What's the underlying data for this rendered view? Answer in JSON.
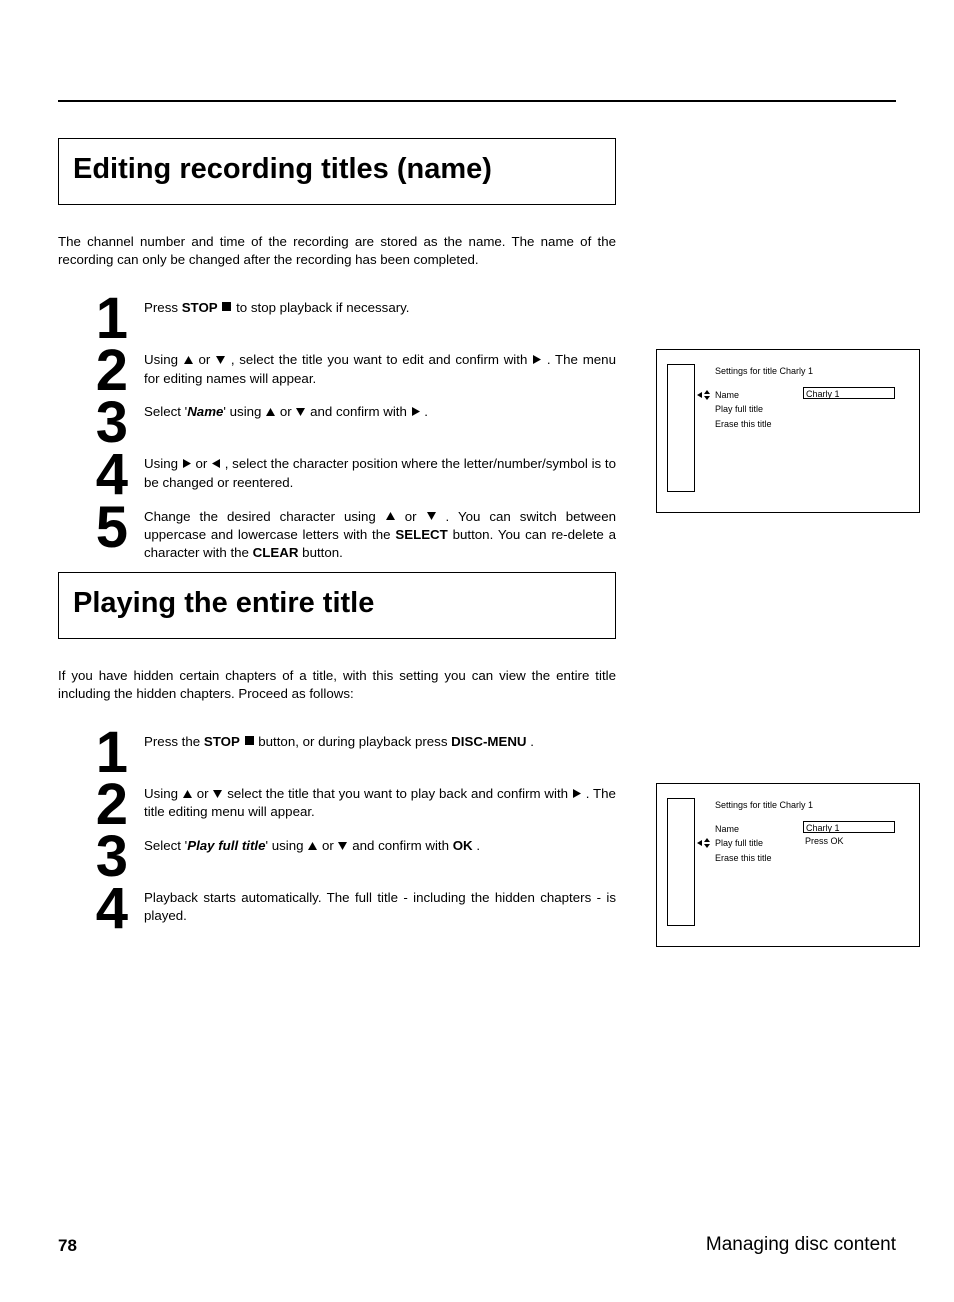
{
  "section1": {
    "title": "Editing recording titles (name)",
    "intro": "The channel number and time of the recording are stored as the name. The name of the recording can only be changed after the recording has been completed.",
    "steps": {
      "s1": {
        "num": "1",
        "pre": "Press ",
        "btn": "STOP",
        "post": " to stop playback if necessary."
      },
      "s2": {
        "num": "2",
        "pre": "Using ",
        "mid": " , select the title you want to edit and confirm with ",
        "post": " . The menu for editing names will appear."
      },
      "s3": {
        "num": "3",
        "pre": "Select '",
        "name": "Name",
        "mid": "' using ",
        "mid2": " and confirm with ",
        "post": " ."
      },
      "s4": {
        "num": "4",
        "pre": "Using ",
        "post": " , select the character position where the letter/number/symbol is to be changed or reentered."
      },
      "s5": {
        "num": "5",
        "pre": "Change the desired character using ",
        "mid": " . You can switch between uppercase and lowercase letters with the ",
        "btn1": "SELECT",
        "mid2": " button. You can re-delete a character with the ",
        "btn2": "CLEAR",
        "post": " button."
      }
    }
  },
  "section2": {
    "title": "Playing the entire title",
    "intro": "If you have hidden certain chapters of a title, with this setting you can view the entire title including the hidden chapters. Proceed as follows:",
    "steps": {
      "s1": {
        "num": "1",
        "pre": "Press the ",
        "btn1": "STOP",
        "mid": " button, or during playback press ",
        "btn2": "DISC-MENU",
        "post": " ."
      },
      "s2": {
        "num": "2",
        "pre": "Using ",
        "mid": " select the title that you want to play back and confirm with ",
        "post": " . The title editing menu will appear."
      },
      "s3": {
        "num": "3",
        "pre": "Select '",
        "name": "Play full title",
        "mid": "' using ",
        "mid2": " and confirm with ",
        "btn": "OK",
        "post": " ."
      },
      "s4": {
        "num": "4",
        "text": "Playback starts automatically. The full title - including the hidden chapters - is played."
      }
    }
  },
  "osd1": {
    "title": "Settings for title Charly 1",
    "items": [
      "Name",
      "Play full title",
      "Erase this title"
    ],
    "value": "Charly 1"
  },
  "osd2": {
    "title": "Settings for title Charly 1",
    "items": [
      "Name",
      "Play full title",
      "Erase this title"
    ],
    "val1": "Charly 1",
    "val2": "Press OK"
  },
  "footer": {
    "page": "78",
    "label": "Managing disc content"
  },
  "glyph": {
    "or": " or "
  }
}
